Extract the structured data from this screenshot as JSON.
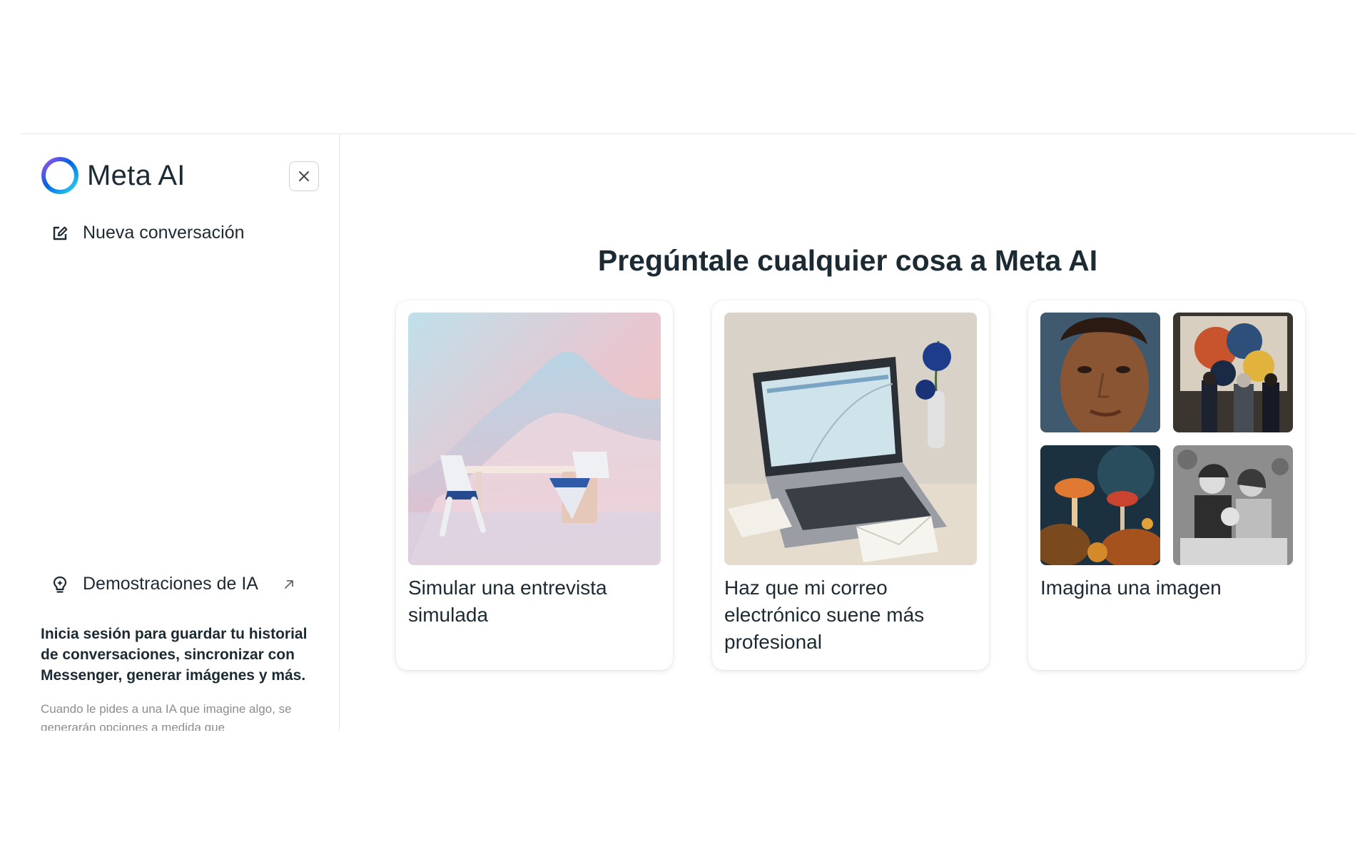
{
  "sidebar": {
    "brand_name": "Meta AI",
    "new_conversation": "Nueva conversación",
    "demos": "Demostraciones de IA",
    "login_prompt": "Inicia sesión para guardar tu historial de conversaciones, sincronizar con Messenger, generar imágenes y más.",
    "fine_print": "Cuando le pides a una IA que imagine algo, se generarán opciones a medida que"
  },
  "main": {
    "headline": "Pregúntale cualquier cosa a Meta AI",
    "cards": [
      {
        "label": "Simular una entrevista simulada",
        "image": "interview-desk-illustration"
      },
      {
        "label": "Haz que mi correo electrónico suene más profesional",
        "image": "laptop-with-envelopes"
      },
      {
        "label": "Imagina una imagen",
        "image": "generated-image-collage"
      }
    ]
  },
  "icons": {
    "brand": "meta-ai-ring-icon",
    "close": "close-icon",
    "new_conversation": "edit-icon",
    "demos": "lightbulb-icon",
    "external": "external-link-icon"
  },
  "colors": {
    "text": "#1c2b33",
    "muted": "#8a8d91",
    "border": "#e4e6eb",
    "brand_gradient": [
      "#0064e0",
      "#2fd7f0",
      "#a64cf0"
    ]
  }
}
